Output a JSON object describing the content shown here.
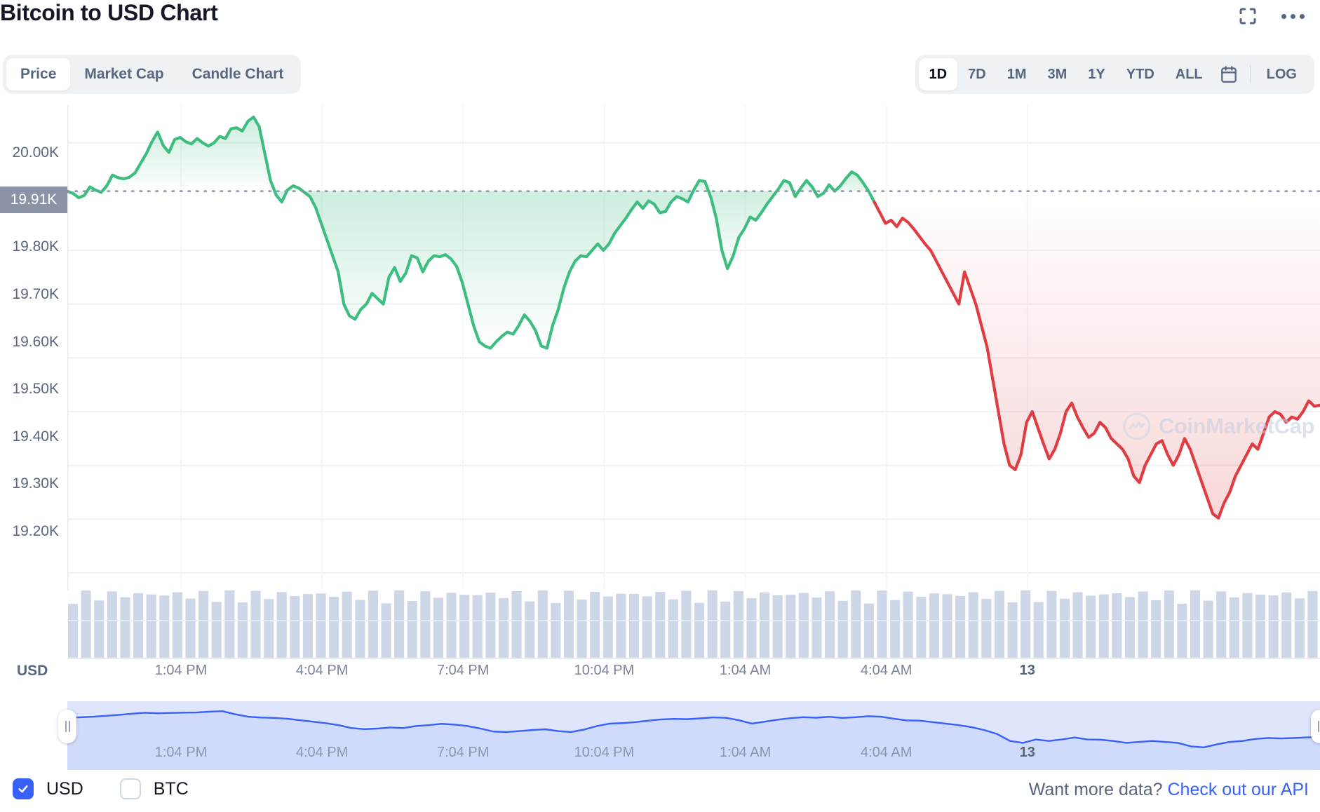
{
  "header": {
    "title": "Bitcoin to USD Chart",
    "fullscreen_icon": "expand-icon",
    "more_icon": "more-options-icon"
  },
  "chart_type_tabs": [
    {
      "label": "Price",
      "active": true
    },
    {
      "label": "Market Cap",
      "active": false
    },
    {
      "label": "Candle Chart",
      "active": false
    }
  ],
  "range_tabs": [
    {
      "label": "1D",
      "active": true
    },
    {
      "label": "7D",
      "active": false
    },
    {
      "label": "1M",
      "active": false
    },
    {
      "label": "3M",
      "active": false
    },
    {
      "label": "1Y",
      "active": false
    },
    {
      "label": "YTD",
      "active": false
    },
    {
      "label": "ALL",
      "active": false
    }
  ],
  "calendar_icon": "calendar-icon",
  "log_toggle": {
    "label": "LOG",
    "active": false
  },
  "watermark": {
    "text": "CoinMarketCap",
    "icon": "coinmarketcap-logo-icon"
  },
  "axis": {
    "currency_label": "USD",
    "current_price_label": "19.91K"
  },
  "footer": {
    "currency_options": [
      {
        "label": "USD",
        "checked": true
      },
      {
        "label": "BTC",
        "checked": false
      }
    ],
    "api_prompt": "Want more data? ",
    "api_link": "Check out our API"
  },
  "chart_data": {
    "type": "line",
    "title": "Bitcoin to USD Chart",
    "subtitle": "",
    "xlabel": "",
    "ylabel": "USD",
    "grid": true,
    "legend": false,
    "ylim": [
      19170,
      20070
    ],
    "yticks": [
      20000,
      19800,
      19700,
      19600,
      19500,
      19400,
      19300,
      19200
    ],
    "ytick_labels": [
      "20.00K",
      "19.80K",
      "19.70K",
      "19.60K",
      "19.50K",
      "19.40K",
      "19.30K",
      "19.20K"
    ],
    "reference_line": {
      "value": 19910,
      "label": "19.91K",
      "style": "dotted"
    },
    "xticks": [
      "1:04 PM",
      "4:04 PM",
      "7:04 PM",
      "10:04 PM",
      "1:04 AM",
      "4:04 AM",
      "13"
    ],
    "xtick_positions": [
      0.0907,
      0.2033,
      0.3159,
      0.4286,
      0.5412,
      0.6538,
      0.7664
    ],
    "colors": {
      "up": "#3ebd80",
      "down": "#e03c42",
      "navigator": "#3861fb",
      "reference": "#8a94a6"
    },
    "series": [
      {
        "name": "BTC/USD",
        "values": [
          19910,
          19906,
          19898,
          19902,
          19918,
          19912,
          19908,
          19920,
          19940,
          19935,
          19933,
          19936,
          19944,
          19962,
          19980,
          20002,
          20020,
          19995,
          19982,
          20006,
          20010,
          20002,
          19998,
          20008,
          20000,
          19994,
          20000,
          20012,
          20008,
          20026,
          20028,
          20022,
          20040,
          20048,
          20030,
          19980,
          19930,
          19903,
          19890,
          19912,
          19920,
          19916,
          19908,
          19900,
          19880,
          19850,
          19820,
          19790,
          19760,
          19700,
          19678,
          19672,
          19690,
          19700,
          19720,
          19710,
          19700,
          19750,
          19768,
          19742,
          19758,
          19790,
          19786,
          19760,
          19780,
          19790,
          19788,
          19792,
          19784,
          19770,
          19740,
          19700,
          19660,
          19630,
          19622,
          19618,
          19630,
          19640,
          19648,
          19644,
          19660,
          19680,
          19668,
          19650,
          19622,
          19618,
          19660,
          19690,
          19730,
          19760,
          19780,
          19790,
          19788,
          19800,
          19812,
          19800,
          19812,
          19832,
          19846,
          19860,
          19876,
          19890,
          19878,
          19892,
          19886,
          19870,
          19872,
          19890,
          19900,
          19896,
          19890,
          19912,
          19930,
          19928,
          19900,
          19860,
          19800,
          19766,
          19790,
          19824,
          19840,
          19862,
          19856,
          19870,
          19886,
          19900,
          19914,
          19930,
          19926,
          19900,
          19916,
          19930,
          19918,
          19900,
          19906,
          19922,
          19910,
          19920,
          19934,
          19946,
          19940,
          19926,
          19910,
          19890,
          19870,
          19850,
          19856,
          19844,
          19860,
          19852,
          19840,
          19826,
          19812,
          19800,
          19780,
          19760,
          19740,
          19720,
          19700,
          19760,
          19730,
          19700,
          19660,
          19620,
          19560,
          19500,
          19440,
          19400,
          19392,
          19420,
          19480,
          19500,
          19470,
          19440,
          19412,
          19430,
          19460,
          19500,
          19516,
          19490,
          19470,
          19452,
          19460,
          19480,
          19470,
          19450,
          19440,
          19430,
          19412,
          19380,
          19368,
          19400,
          19420,
          19440,
          19446,
          19420,
          19400,
          19420,
          19450,
          19430,
          19400,
          19370,
          19340,
          19310,
          19302,
          19330,
          19350,
          19380,
          19400,
          19420,
          19440,
          19430,
          19460,
          19490,
          19500,
          19495,
          19480,
          19490,
          19486,
          19500,
          19520,
          19510,
          19512
        ]
      }
    ],
    "navigator": {
      "values": [
        19910,
        19918,
        19930,
        19948,
        19968,
        19990,
        20010,
        20000,
        20006,
        20012,
        20016,
        20032,
        20042,
        19980,
        19930,
        19912,
        19906,
        19890,
        19860,
        19830,
        19800,
        19760,
        19700,
        19678,
        19690,
        19712,
        19700,
        19740,
        19760,
        19786,
        19770,
        19740,
        19690,
        19630,
        19620,
        19640,
        19660,
        19676,
        19640,
        19620,
        19670,
        19740,
        19790,
        19800,
        19820,
        19850,
        19876,
        19886,
        19880,
        19896,
        19916,
        19908,
        19860,
        19790,
        19830,
        19870,
        19900,
        19920,
        19910,
        19928,
        19906,
        19920,
        19940,
        19930,
        19890,
        19855,
        19850,
        19820,
        19790,
        19760,
        19720,
        19660,
        19580,
        19440,
        19400,
        19470,
        19440,
        19470,
        19510,
        19470,
        19465,
        19440,
        19400,
        19420,
        19440,
        19420,
        19400,
        19330,
        19310,
        19370,
        19420,
        19440,
        19480,
        19500,
        19490,
        19500,
        19512,
        19515
      ],
      "range_start": 0.0,
      "range_end": 1.0
    },
    "volume": {
      "type": "bar",
      "bar_count": 96,
      "color": "#c6d0e4"
    }
  }
}
